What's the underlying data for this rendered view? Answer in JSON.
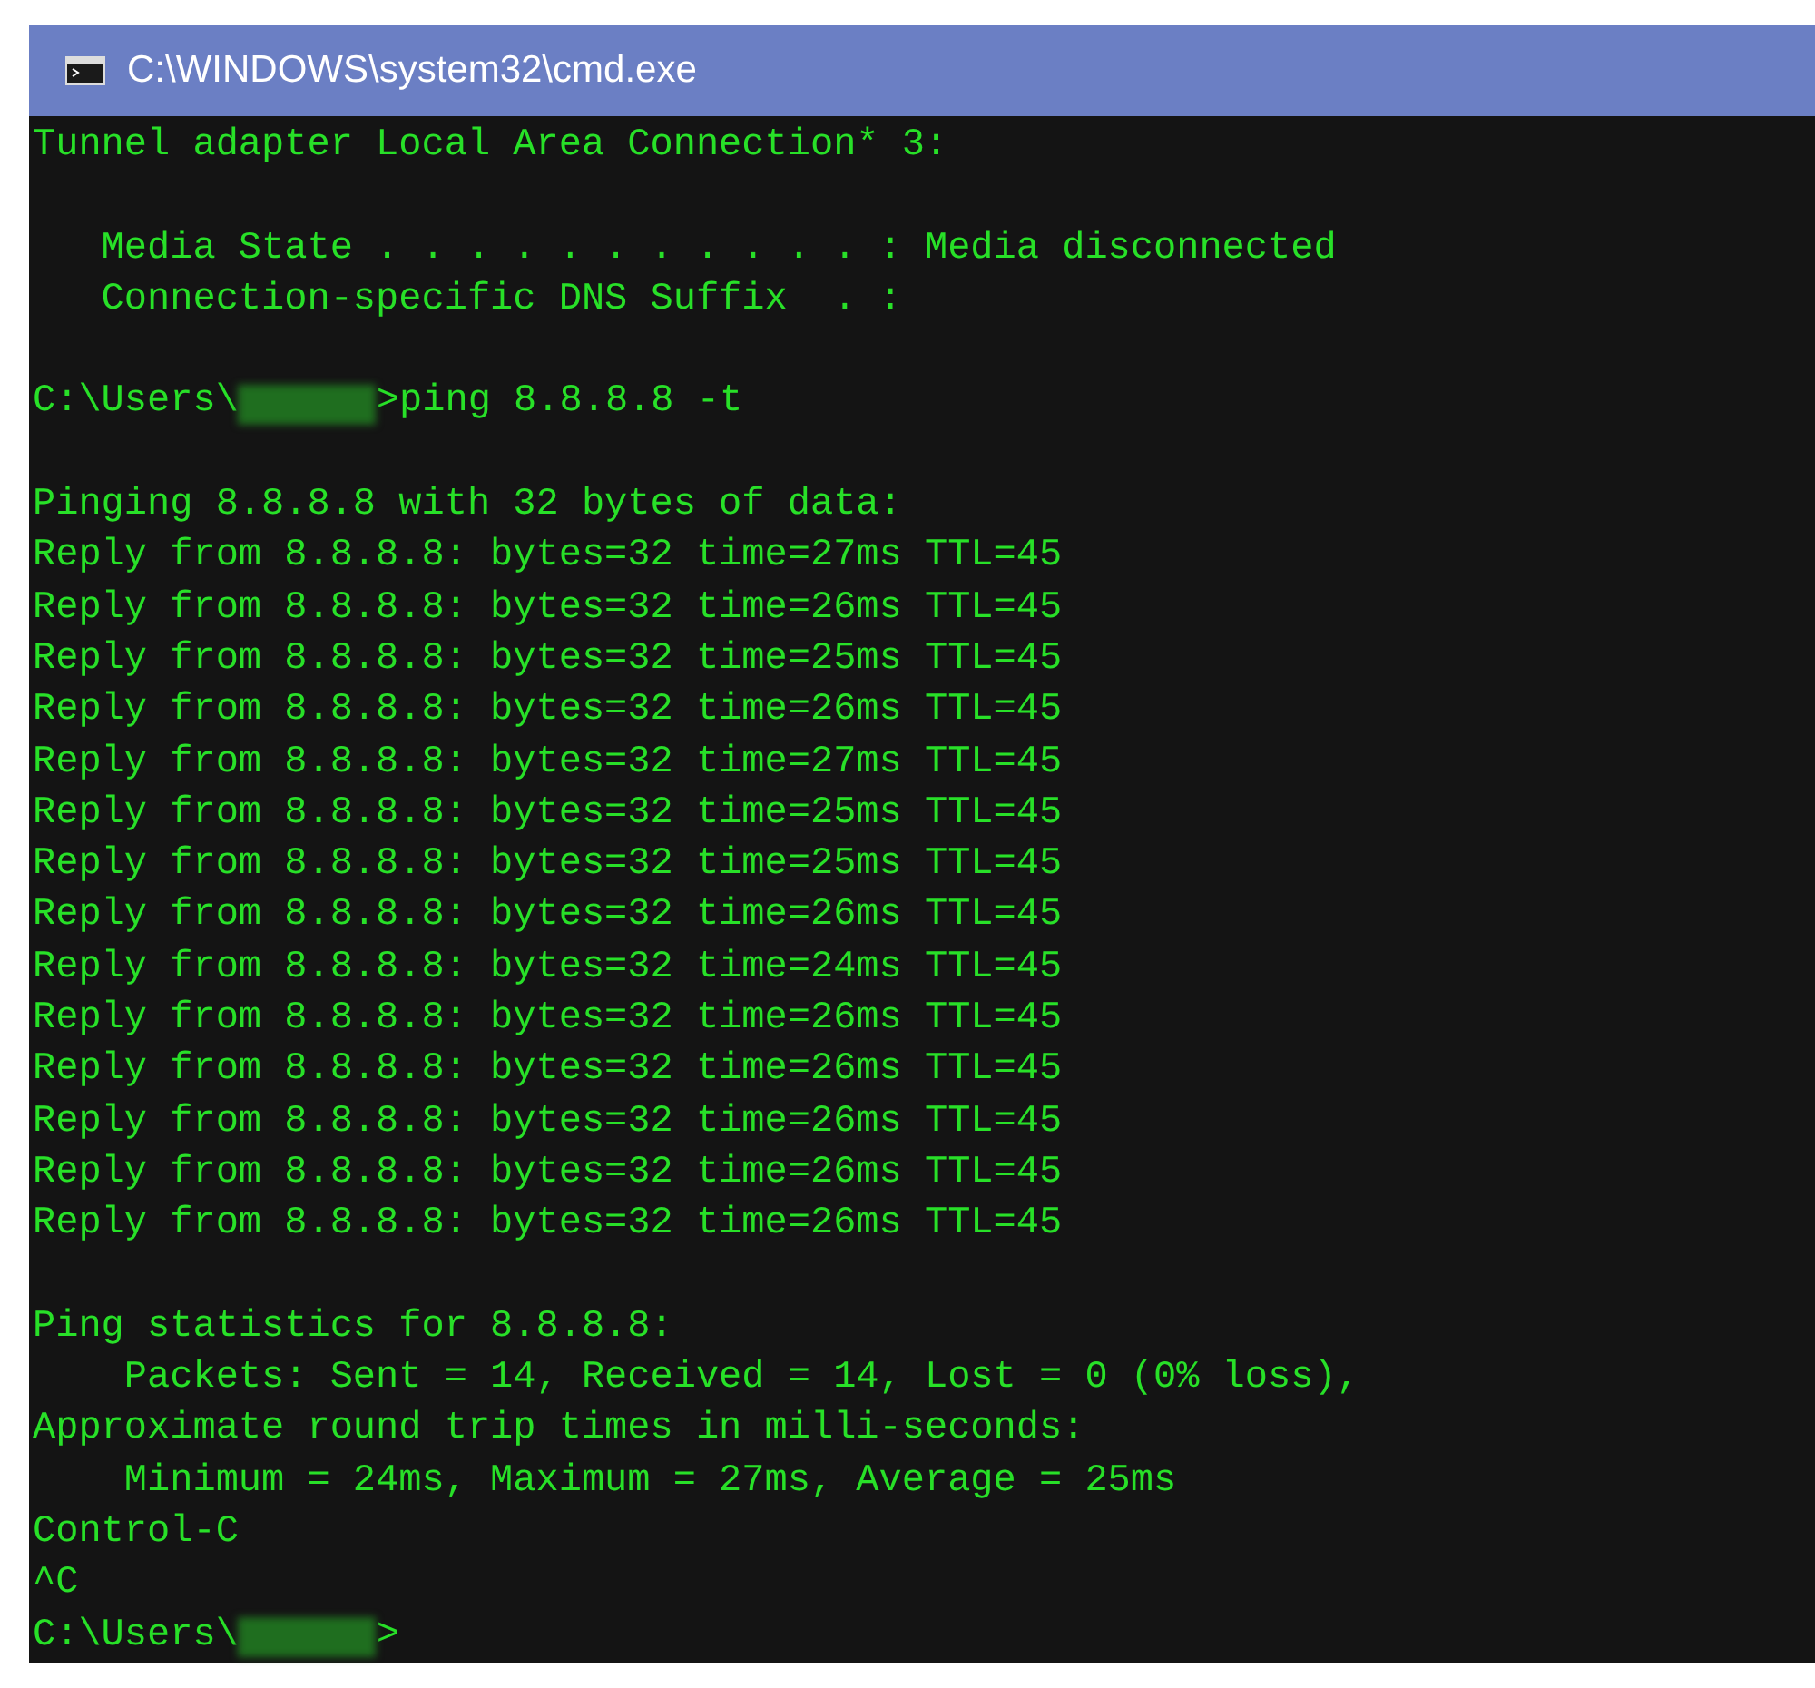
{
  "window": {
    "title": "C:\\WINDOWS\\system32\\cmd.exe"
  },
  "console_lines": [
    {
      "kind": "text",
      "text": "Tunnel adapter Local Area Connection* 3:"
    },
    {
      "kind": "blank"
    },
    {
      "kind": "text",
      "text": "   Media State . . . . . . . . . . . : Media disconnected"
    },
    {
      "kind": "text",
      "text": "   Connection-specific DNS Suffix  . :"
    },
    {
      "kind": "blank"
    },
    {
      "kind": "prompt",
      "prefix": "C:\\Users\\",
      "suffix": ">ping 8.8.8.8 -t"
    },
    {
      "kind": "blank"
    },
    {
      "kind": "text",
      "text": "Pinging 8.8.8.8 with 32 bytes of data:"
    },
    {
      "kind": "text",
      "text": "Reply from 8.8.8.8: bytes=32 time=27ms TTL=45"
    },
    {
      "kind": "text",
      "text": "Reply from 8.8.8.8: bytes=32 time=26ms TTL=45"
    },
    {
      "kind": "text",
      "text": "Reply from 8.8.8.8: bytes=32 time=25ms TTL=45"
    },
    {
      "kind": "text",
      "text": "Reply from 8.8.8.8: bytes=32 time=26ms TTL=45"
    },
    {
      "kind": "text",
      "text": "Reply from 8.8.8.8: bytes=32 time=27ms TTL=45"
    },
    {
      "kind": "text",
      "text": "Reply from 8.8.8.8: bytes=32 time=25ms TTL=45"
    },
    {
      "kind": "text",
      "text": "Reply from 8.8.8.8: bytes=32 time=25ms TTL=45"
    },
    {
      "kind": "text",
      "text": "Reply from 8.8.8.8: bytes=32 time=26ms TTL=45"
    },
    {
      "kind": "text",
      "text": "Reply from 8.8.8.8: bytes=32 time=24ms TTL=45"
    },
    {
      "kind": "text",
      "text": "Reply from 8.8.8.8: bytes=32 time=26ms TTL=45"
    },
    {
      "kind": "text",
      "text": "Reply from 8.8.8.8: bytes=32 time=26ms TTL=45"
    },
    {
      "kind": "text",
      "text": "Reply from 8.8.8.8: bytes=32 time=26ms TTL=45"
    },
    {
      "kind": "text",
      "text": "Reply from 8.8.8.8: bytes=32 time=26ms TTL=45"
    },
    {
      "kind": "text",
      "text": "Reply from 8.8.8.8: bytes=32 time=26ms TTL=45"
    },
    {
      "kind": "blank"
    },
    {
      "kind": "text",
      "text": "Ping statistics for 8.8.8.8:"
    },
    {
      "kind": "text",
      "text": "    Packets: Sent = 14, Received = 14, Lost = 0 (0% loss),"
    },
    {
      "kind": "text",
      "text": "Approximate round trip times in milli-seconds:"
    },
    {
      "kind": "text",
      "text": "    Minimum = 24ms, Maximum = 27ms, Average = 25ms"
    },
    {
      "kind": "text",
      "text": "Control-C"
    },
    {
      "kind": "text",
      "text": "^C"
    },
    {
      "kind": "prompt",
      "prefix": "C:\\Users\\",
      "suffix": ">"
    }
  ]
}
